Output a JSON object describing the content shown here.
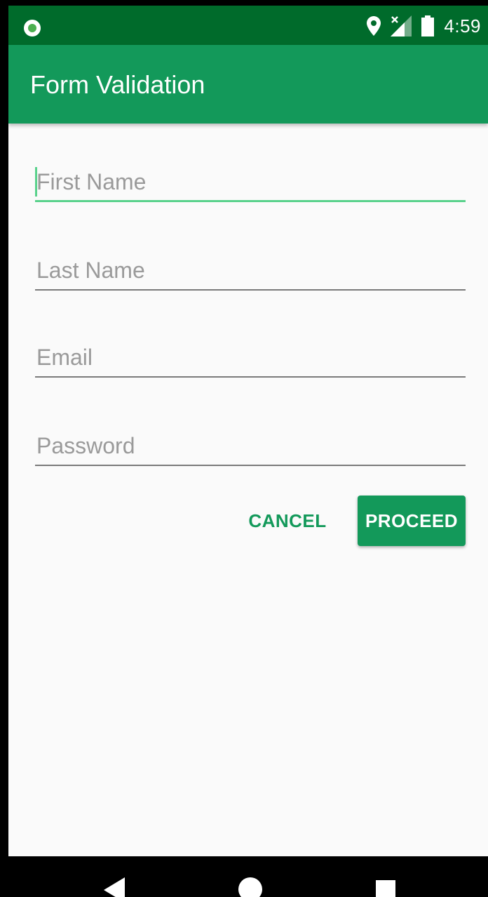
{
  "status_bar": {
    "time": "4:59",
    "icons": [
      "recording-icon",
      "location-icon",
      "signal-icon",
      "battery-icon"
    ]
  },
  "app_bar": {
    "title": "Form Validation"
  },
  "form": {
    "first_name": {
      "placeholder": "First Name",
      "value": ""
    },
    "last_name": {
      "placeholder": "Last Name",
      "value": ""
    },
    "email": {
      "placeholder": "Email",
      "value": ""
    },
    "password": {
      "placeholder": "Password",
      "value": ""
    }
  },
  "actions": {
    "cancel_label": "CANCEL",
    "proceed_label": "PROCEED"
  },
  "colors": {
    "primary": "#13995a",
    "primary_dark": "#006b2b",
    "accent_focus": "#5ad28c",
    "background": "#fafafa"
  },
  "nav_bar": {
    "icons": [
      "back-icon",
      "home-icon",
      "recents-icon"
    ]
  }
}
